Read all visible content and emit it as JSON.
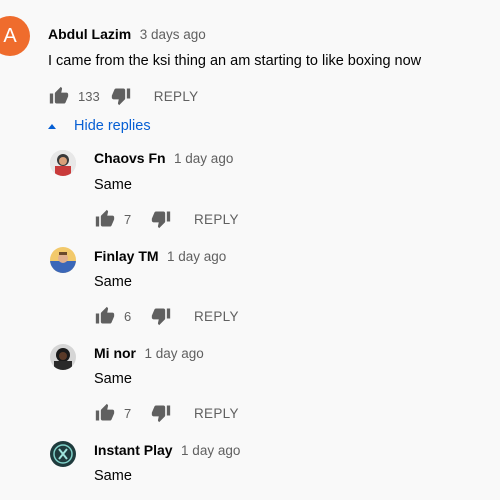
{
  "comment": {
    "avatar_letter": "A",
    "author": "Abdul Lazim",
    "time": "3 days ago",
    "text": "I came from the ksi thing an am starting to like boxing now",
    "likes": "133",
    "reply_label": "REPLY"
  },
  "hide_replies_label": "Hide replies",
  "replies": [
    {
      "author": "Chaovs Fn",
      "time": "1 day ago",
      "text": "Same",
      "likes": "7",
      "reply_label": "REPLY"
    },
    {
      "author": "Finlay TM",
      "time": "1 day ago",
      "text": "Same",
      "likes": "6",
      "reply_label": "REPLY"
    },
    {
      "author": "Mi nor",
      "time": "1 day ago",
      "text": "Same",
      "likes": "7",
      "reply_label": "REPLY"
    },
    {
      "author": "Instant Play",
      "time": "1 day ago",
      "text": "Same"
    }
  ],
  "colors": {
    "link": "#065fd4",
    "avatar_a": "#ef6c2d"
  },
  "icons": [
    "thumb-up-icon",
    "thumb-down-icon",
    "caret-up-icon"
  ]
}
